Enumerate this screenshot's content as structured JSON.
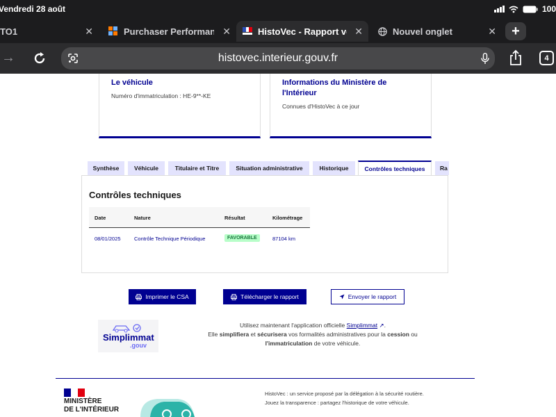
{
  "status_bar": {
    "date": "Vendredi 28 août",
    "battery": "100"
  },
  "tabs": [
    {
      "label": "TO1"
    },
    {
      "label": "Purchaser Performance"
    },
    {
      "label": "HistoVec - Rapport ven"
    },
    {
      "label": "Nouvel onglet"
    }
  ],
  "address": {
    "url": "histovec.interieur.gouv.fr",
    "tab_count": "4"
  },
  "cards": [
    {
      "title": "Le véhicule",
      "subtitle": "Numéro d'immatriculation : HE-9**-KE"
    },
    {
      "title": "Informations du Ministère de l'Intérieur",
      "subtitle": "Connues d'HistoVec à ce jour"
    }
  ],
  "nav_tabs": [
    "Synthèse",
    "Véhicule",
    "Titulaire et Titre",
    "Situation administrative",
    "Historique",
    "Contrôles techniques",
    "Ra"
  ],
  "panel": {
    "title": "Contrôles techniques",
    "columns": [
      "Date",
      "Nature",
      "Résultat",
      "Kilométrage"
    ],
    "rows": [
      {
        "date": "08/01/2025",
        "nature": "Contrôle Technique Périodique",
        "result": "FAVORABLE",
        "mileage": "87104 km"
      }
    ]
  },
  "actions": {
    "print": "Imprimer le CSA",
    "download": "Télécharger le rapport",
    "send": "Envoyer le rapport"
  },
  "promo": {
    "logo_text": "Simplimmat",
    "logo_sub": ".gouv",
    "line1_pre": "Utilisez maintenant l'application officielle",
    "link": "Simplimmat",
    "line2_a": "Elle",
    "line2_b": "simplifiera",
    "line2_c": "et",
    "line2_d": "sécurisera",
    "line2_e": "vos formalités administratives pour la",
    "line2_f": "cession",
    "line2_g": "ou",
    "line3_a": "l'immatriculation",
    "line3_b": "de votre véhicule."
  },
  "footer": {
    "ministry_line1": "MINISTÈRE",
    "ministry_line2": "DE L'INTÉRIEUR",
    "text1": "HistoVec : un service proposé par la délégation à la sécurité routière.",
    "text2": "Jouez la transparence : partagez l'historique de votre véhicule."
  },
  "colors": {
    "accent": "#000091",
    "success_bg": "#b8fec9",
    "success_fg": "#18753c",
    "tab_bg": "#e3e3fd"
  }
}
